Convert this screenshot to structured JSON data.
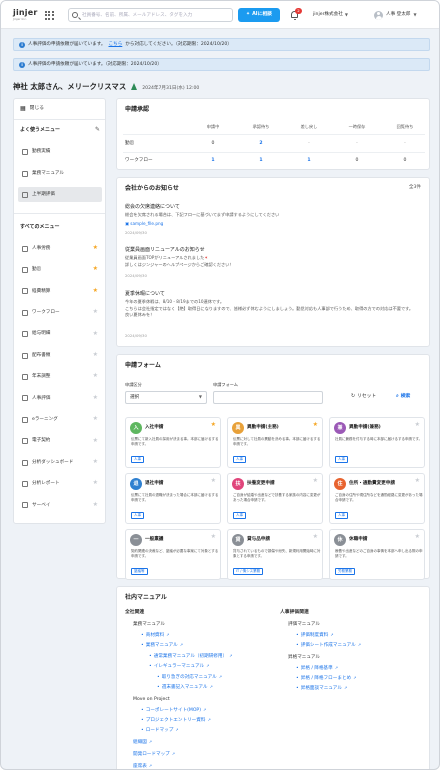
{
  "header": {
    "logo": "jinjer",
    "logo_sub": "Jinjer Inc.",
    "search_placeholder": "社員番号、名前、所属、メールアドレス、タグを入力",
    "ai_button": "AIに相談",
    "notification_count": "2",
    "company": "jinjer株式会社",
    "user": "人事 登太郎"
  },
  "notices": [
    {
      "prefix": "人事評価の申請依頼が届いています。",
      "link": "こちら",
      "suffix": "から対応してください。（対応期限：2024/10/20）"
    },
    {
      "prefix": "人事評価の申請依頼が届いています。（対応期限：2024/10/20）",
      "link": "",
      "suffix": ""
    }
  ],
  "greeting": {
    "name": "神社 太郎さん、メリークリスマス",
    "date": "2024年7月31日(水) 12:00"
  },
  "sidebar": {
    "close_label": "閉じる",
    "frequent_title": "よく使うメニュー",
    "frequent": [
      {
        "label": "勤務実績"
      },
      {
        "label": "業務マニュアル"
      },
      {
        "label": "上半期評価"
      }
    ],
    "all_title": "すべてのメニュー",
    "all": [
      {
        "label": "人事労務",
        "fav": true
      },
      {
        "label": "勤怠",
        "fav": true
      },
      {
        "label": "経費精算",
        "fav": true
      },
      {
        "label": "ワークフロー",
        "fav": false
      },
      {
        "label": "給与明細",
        "fav": false
      },
      {
        "label": "配布書類",
        "fav": false
      },
      {
        "label": "年末調整",
        "fav": false
      },
      {
        "label": "人事評価",
        "fav": false
      },
      {
        "label": "eラーニング",
        "fav": false
      },
      {
        "label": "電子契約",
        "fav": false
      },
      {
        "label": "分析ダッシュボード",
        "fav": false
      },
      {
        "label": "分析レポート",
        "fav": false
      },
      {
        "label": "サーベイ",
        "fav": false
      }
    ]
  },
  "approvals": {
    "title": "申請承認",
    "columns": [
      "申請中",
      "承認待ち",
      "差し戻し",
      "一時保存",
      "回覧待ち"
    ],
    "rows": [
      {
        "label": "勤怠",
        "values": [
          "0",
          "2",
          "-",
          "-",
          "-"
        ]
      },
      {
        "label": "ワークフロー",
        "values": [
          "1",
          "1",
          "1",
          "0",
          "0"
        ]
      }
    ]
  },
  "news": {
    "title": "会社からのお知らせ",
    "count": "全3件",
    "items": [
      {
        "title": "総会の欠席連絡について",
        "body": "総会を欠席される場合は、下記フローに基づいてまず申請するようにしてください",
        "file": "sample_file.png",
        "date": "2024/09/30"
      },
      {
        "title": "従業員画面リニューアルのお知らせ",
        "body": "従業員画面TOPがリニューアルされました",
        "body2": "詳しくはジンジャーのヘルプページからご確認ください！",
        "date": "2024/09/30"
      },
      {
        "title": "夏季休暇について",
        "body": "今年の夏季休暇は、8/10 - 8/19までの10連休です。",
        "body2": "こちらは会社指定ではなく【絶】取得日になりますので、皆様必ず休むようにしましょう。勤怠対応も人事部で行うため、取得の方での対応は不要です。",
        "body3": "良い夏休みを！",
        "date": "2024/09/30"
      }
    ]
  },
  "forms": {
    "title": "申請フォーム",
    "category_label": "申請区分",
    "category_value": "選択",
    "form_label": "申請フォーム",
    "reset": "リセット",
    "search": "検索",
    "apps": [
      {
        "title": "入社申請",
        "desc": "伝票にて新入社員の採用が決まる事。本部に届けるする申請です。",
        "tag": "人事",
        "color": "#5fb760",
        "icon": "入",
        "fav": true
      },
      {
        "title": "異動申請(主務)",
        "desc": "伝票に対して社員の異動を決める事。本部に届けるする申請です。",
        "tag": "人事",
        "color": "#e8a13a",
        "icon": "異",
        "fav": true
      },
      {
        "title": "異動申請(兼務)",
        "desc": "社員に兼務を付与する時に本部に届けるする申請です。",
        "tag": "人事",
        "color": "#9b59b6",
        "icon": "兼",
        "fav": false
      },
      {
        "title": "退社申請",
        "desc": "伝票にて社員の退職が決まった場合に本部に届けるする申請です。",
        "tag": "人事",
        "color": "#2f80d0",
        "icon": "退",
        "fav": false
      },
      {
        "title": "扶養変更申請",
        "desc": "ご自身が結婚や出産などで扶養する家族の内容に変更があった場合申請です。",
        "tag": "人事",
        "color": "#e0457b",
        "icon": "扶",
        "fav": false
      },
      {
        "title": "住所・通勤費変更申請",
        "desc": "ご自身の住所や現住所などを通勤経路に変更があった場合申請です。",
        "tag": "人事",
        "color": "#e8632f",
        "icon": "住",
        "fav": false
      },
      {
        "title": "一般稟議",
        "desc": "契約関連の決裁など、稟議が必要な事案にて対象とする申請です。",
        "tag": "稟議等",
        "color": "#8a8f96",
        "icon": "一",
        "fav": false
      },
      {
        "title": "貸与品申請",
        "desc": "貸与されているもので損傷や紛失、新規利用開始時に対象とする申請です。",
        "tag": "IT / 情シス業務",
        "color": "#8a8f96",
        "icon": "貸",
        "fav": false
      },
      {
        "title": "休職申請",
        "desc": "療養や出産などのご自身の事情を本部へ申し出る際の申請です。",
        "tag": "労務業務",
        "color": "#8a8f96",
        "icon": "休",
        "fav": false
      }
    ]
  },
  "manual": {
    "title": "社内マニュアル",
    "left_section": "全社関連",
    "left_sub1": "業務マニュアル",
    "left_links1": [
      "商材資料",
      "業務マニュアル"
    ],
    "left_links1b": [
      "通常業務マニュアル（初期研修用）",
      "イレギュラーマニュアル"
    ],
    "left_links1c": [
      "取り急ぎの対応マニュアル",
      "週末書記入マニュアル"
    ],
    "left_sub2": "Move on Project",
    "left_links2": [
      "コーポレートサイト(MOP)",
      "プロジェクトエントリー資料",
      "ロードマップ"
    ],
    "left_links3": [
      "組織図",
      "開発ロードマップ",
      "座席表"
    ],
    "right_section": "人事評価関連",
    "right_sub1": "評価マニュアル",
    "right_links1": [
      "評価制度資料",
      "評価シート作成マニュアル"
    ],
    "right_sub2": "昇格マニュアル",
    "right_links2": [
      "昇格 / 降格基準",
      "昇格 / 降格フローまとめ",
      "昇格面談マニュアル"
    ]
  }
}
